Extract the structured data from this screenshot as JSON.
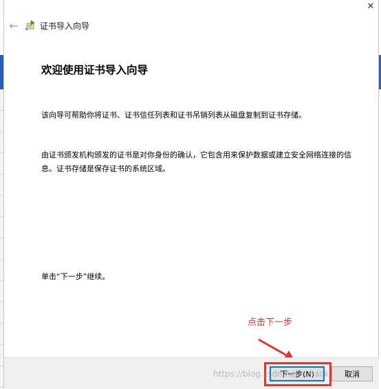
{
  "window": {
    "title": "证书导入向导",
    "close_glyph": "✕",
    "back_glyph": "←"
  },
  "content": {
    "heading": "欢迎使用证书导入向导",
    "paragraph1": "该向导可帮助你将证书、证书信任列表和证书吊销列表从磁盘复制到证书存储。",
    "paragraph2": "由证书颁发机构颁发的证书是对你身份的确认，它包含用来保护数据或建立安全网络连接的信息。证书存储是保存证书的系统区域。",
    "paragraph3": "单击“下一步”继续。"
  },
  "annotation": {
    "text": "点击下一步",
    "color": "#e8332b"
  },
  "footer": {
    "next_label": "下一步(N)",
    "cancel_label": "取消"
  },
  "watermark": {
    "text": "https://blog.csdn.net/...hack"
  },
  "icons": {
    "back": "back-arrow-icon",
    "wizard": "certificate-wizard-icon",
    "close": "close-icon"
  }
}
